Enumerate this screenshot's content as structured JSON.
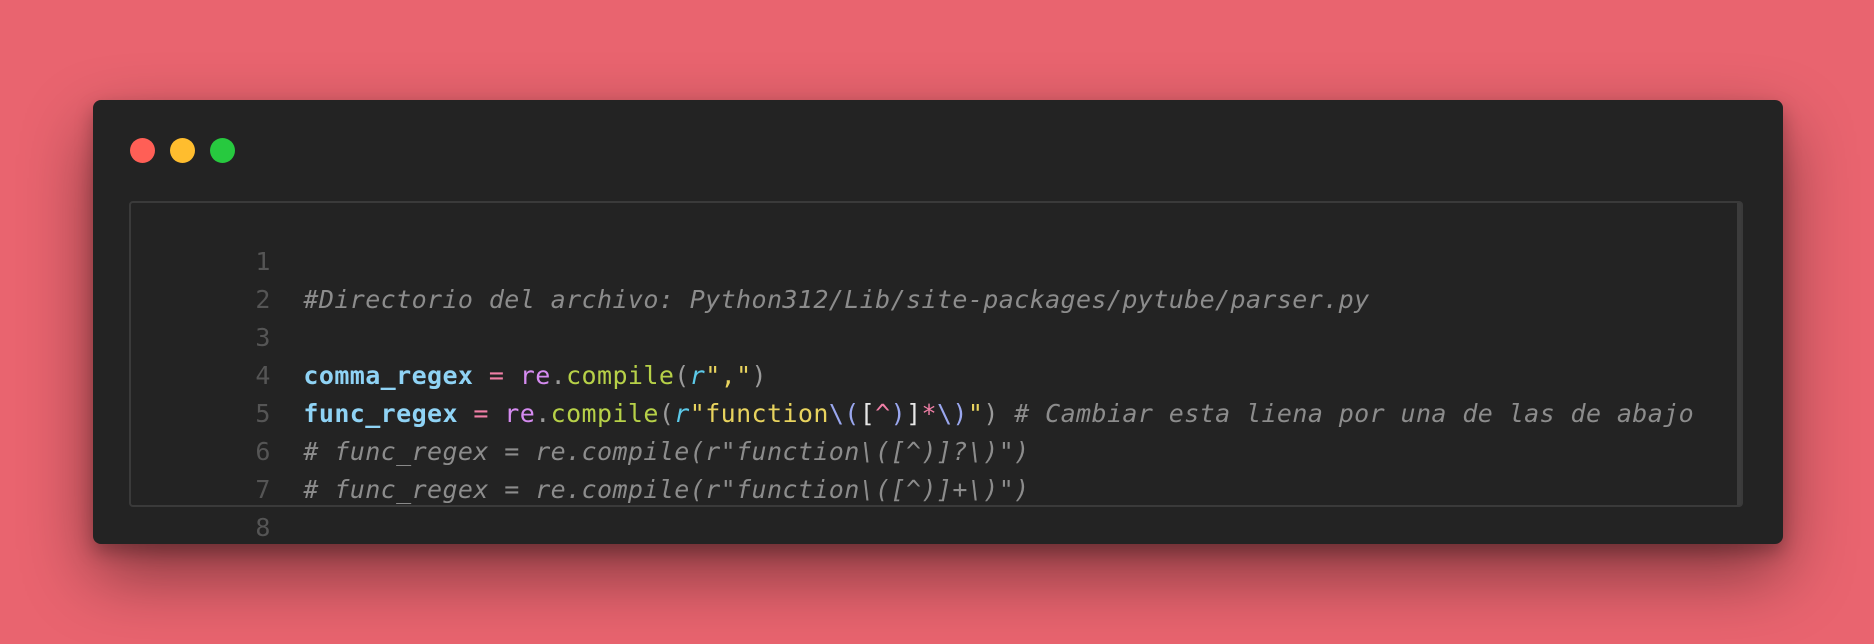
{
  "window": {
    "controls": [
      "close",
      "minimize",
      "maximize"
    ]
  },
  "editor": {
    "line_numbers": [
      "1",
      "2",
      "3",
      "4",
      "5",
      "6",
      "7",
      "8"
    ],
    "line2": {
      "comment": "#Directorio del archivo: Python312/Lib/site-packages/pytube/parser.py"
    },
    "line4": {
      "var": "comma_regex",
      "eq": " = ",
      "module": "re",
      "dot": ".",
      "func": "compile",
      "open": "(",
      "prefix": "r",
      "string": "\",\"",
      "close": ")"
    },
    "line5": {
      "var": "func_regex",
      "eq": " = ",
      "module": "re",
      "dot": ".",
      "func": "compile",
      "open": "(",
      "prefix": "r",
      "quote_open": "\"",
      "word": "function",
      "esc_open": "\\(",
      "bracket_open": "[",
      "caret": "^",
      "esc_paren": ")",
      "bracket_close": "]",
      "star": "*",
      "esc_close": "\\)",
      "quote_close": "\"",
      "close": ")",
      "comment": " # Cambiar esta liena por una de las de abajo"
    },
    "line6": {
      "comment": "# func_regex = re.compile(r\"function\\([^)]?\\)\")"
    },
    "line7": {
      "comment": "# func_regex = re.compile(r\"function\\([^)]+\\)\")"
    }
  },
  "colors": {
    "background": "#e9646f",
    "window": "#232323",
    "close": "#ff5f56",
    "minimize": "#ffbd2e",
    "maximize": "#27c93f"
  }
}
